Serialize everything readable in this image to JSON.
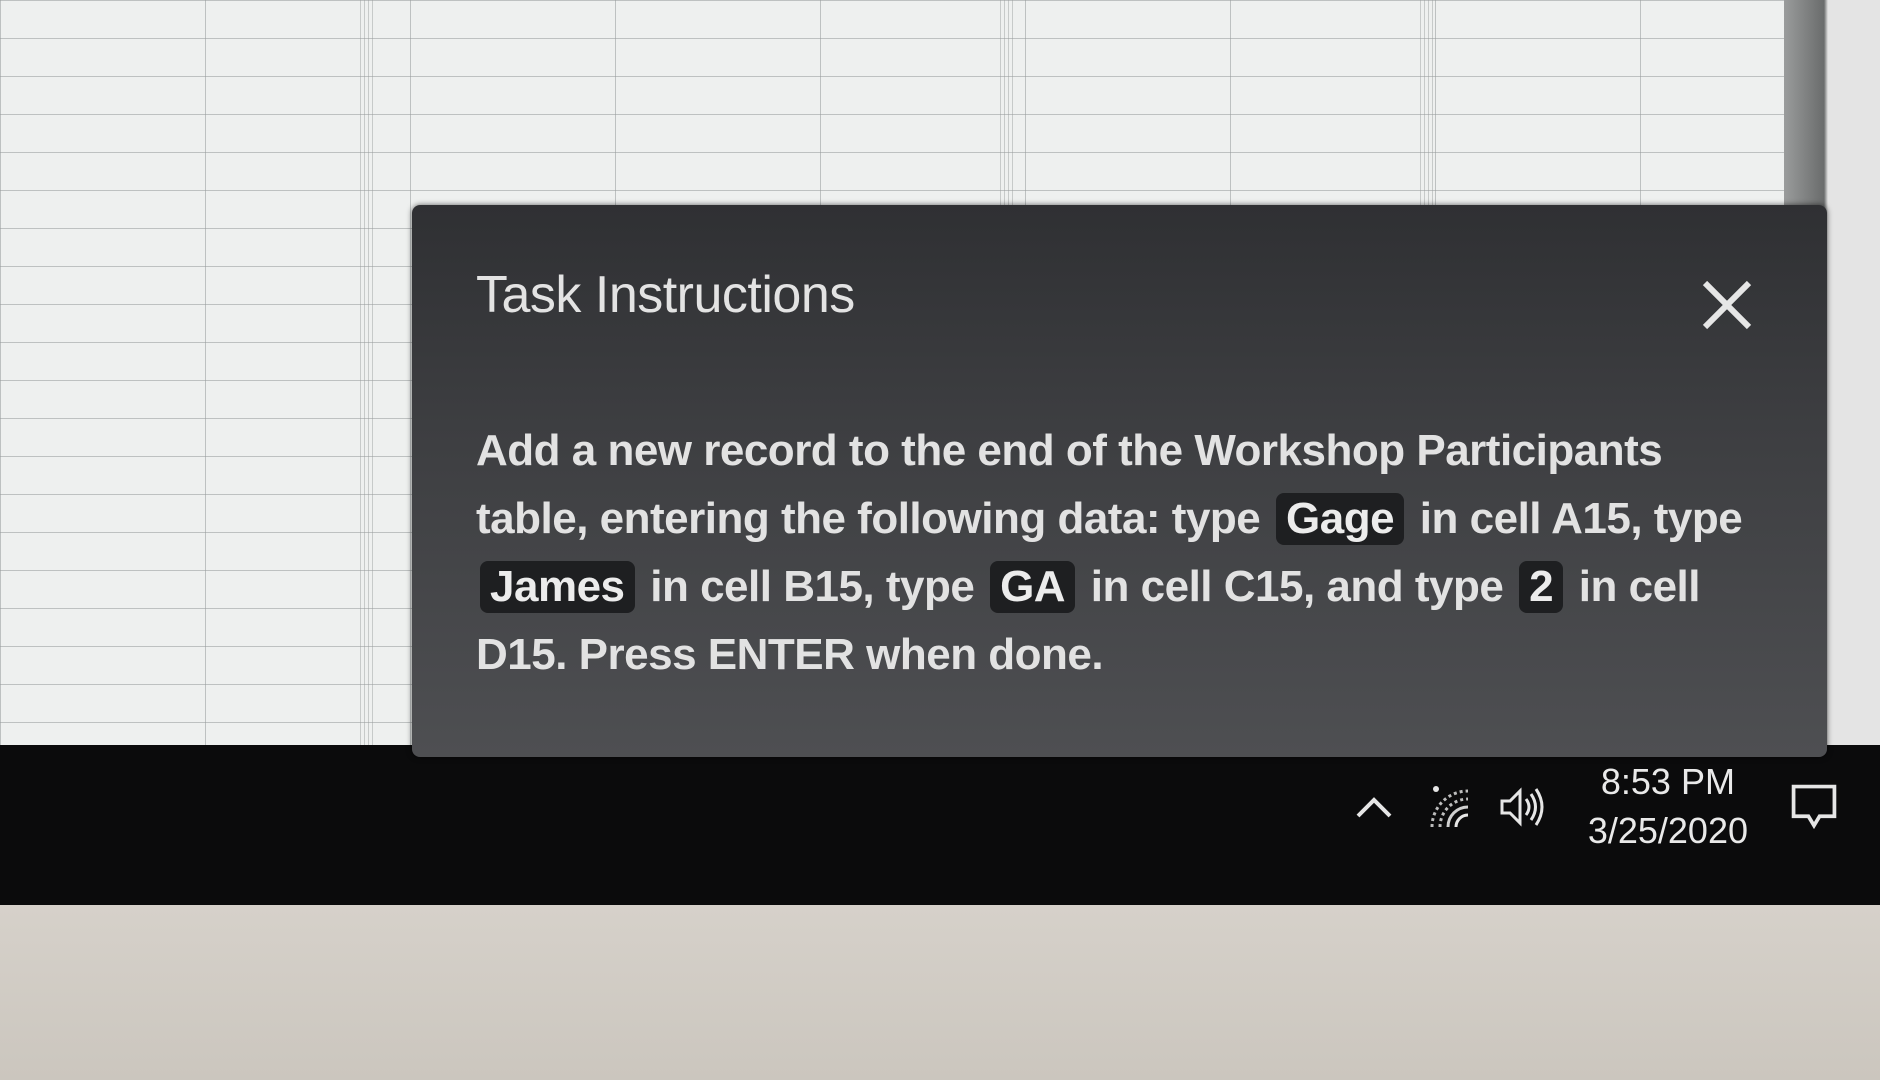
{
  "dialog": {
    "title": "Task Instructions",
    "close_icon": "close-icon",
    "body": {
      "s1": "Add a new record to the end of the Workshop Participants table, entering the following data: type",
      "c1": "Gage",
      "s2": "in cell A15, type",
      "c2": "James",
      "s3": "in cell B15, type",
      "c3": "GA",
      "s4": "in cell C15, and type",
      "c4": "2",
      "s5": "in cell D15. Press ENTER when done."
    }
  },
  "taskbar": {
    "tray_icons": [
      "chevron-up-icon",
      "wifi-icon",
      "speaker-icon",
      "notification-icon"
    ],
    "time": "8:53 PM",
    "date": "3/25/2020"
  }
}
